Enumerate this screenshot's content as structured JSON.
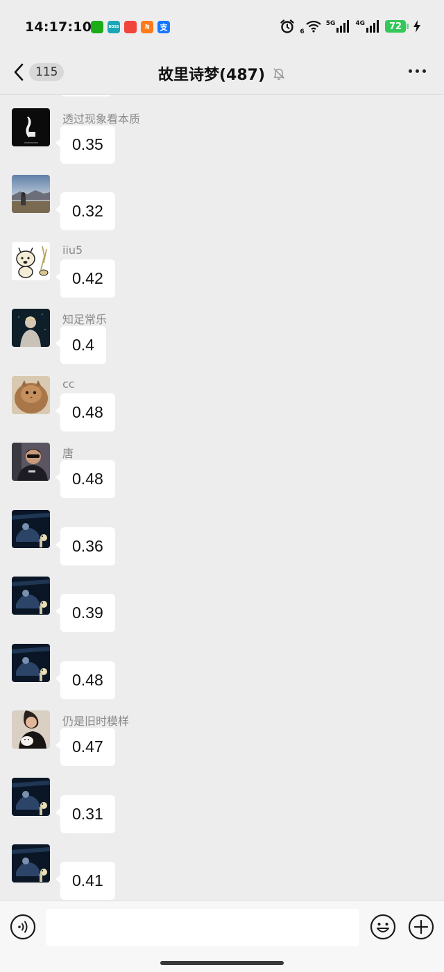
{
  "status_bar": {
    "time": "14:17:10",
    "apps": [
      {
        "name": "wechat",
        "label": "",
        "color": "#1aad19"
      },
      {
        "name": "boss",
        "label": "BOSS",
        "color": "#19a7b8"
      },
      {
        "name": "toutiao",
        "label": "",
        "color": "#f0453a"
      },
      {
        "name": "taobao",
        "label": "淘",
        "color": "#ff7a1a"
      },
      {
        "name": "alipay",
        "label": "支",
        "color": "#1677ff"
      }
    ],
    "wifi_label": "6",
    "net1_label": "5G",
    "net2_label": "4G",
    "battery": "72",
    "battery_color": "#34c759"
  },
  "nav": {
    "unread_count": "115",
    "title": "故里诗梦(487)",
    "muted": true
  },
  "messages": [
    {
      "sender": "透过现象看本质",
      "text": "0.35",
      "avatar": "dark-figure"
    },
    {
      "sender": "",
      "text": "0.32",
      "avatar": "landscape-sky"
    },
    {
      "sender": "iiu5",
      "text": "0.42",
      "avatar": "cartoon-bear"
    },
    {
      "sender": "知足常乐",
      "text": "0.4",
      "avatar": "couple-dark"
    },
    {
      "sender": "cc",
      "text": "0.48",
      "avatar": "fluffy-cat"
    },
    {
      "sender": "唐",
      "text": "0.48",
      "avatar": "man-sunglasses"
    },
    {
      "sender": "",
      "text": "0.36",
      "avatar": "night-car"
    },
    {
      "sender": "",
      "text": "0.39",
      "avatar": "night-car"
    },
    {
      "sender": "",
      "text": "0.48",
      "avatar": "night-car"
    },
    {
      "sender": "仍是旧时模样",
      "text": "0.47",
      "avatar": "person-cat"
    },
    {
      "sender": "",
      "text": "0.31",
      "avatar": "night-car"
    },
    {
      "sender": "",
      "text": "0.41",
      "avatar": "night-car"
    }
  ],
  "input": {
    "value": "",
    "placeholder": ""
  },
  "icons": {
    "back": "chevron-left-icon",
    "mute": "bell-off-icon",
    "more": "more-dots-icon",
    "voice": "voice-icon",
    "emoji": "emoji-icon",
    "plus": "plus-icon"
  }
}
